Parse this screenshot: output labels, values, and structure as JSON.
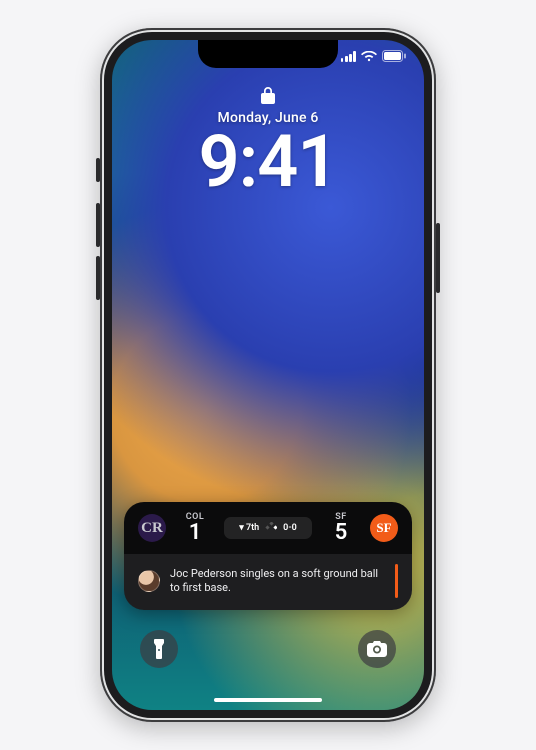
{
  "lock": {
    "date": "Monday, June 6",
    "time": "9:41"
  },
  "status": {
    "signal_bars": 4,
    "wifi": true,
    "battery_full": true
  },
  "live_activity": {
    "away": {
      "abbr": "COL",
      "score": "1",
      "logo_text": "CR"
    },
    "home": {
      "abbr": "SF",
      "score": "5",
      "logo_text": "SF"
    },
    "inning": "▾ 7th",
    "count": "0-0",
    "bases": {
      "first": true,
      "second": false,
      "third": false
    },
    "news": "Joc Pederson singles on a soft ground ball to first base.",
    "accent_color": "#f25c19"
  },
  "icons": {
    "lock": "lock-icon",
    "flashlight": "flashlight-icon",
    "camera": "camera-icon"
  }
}
